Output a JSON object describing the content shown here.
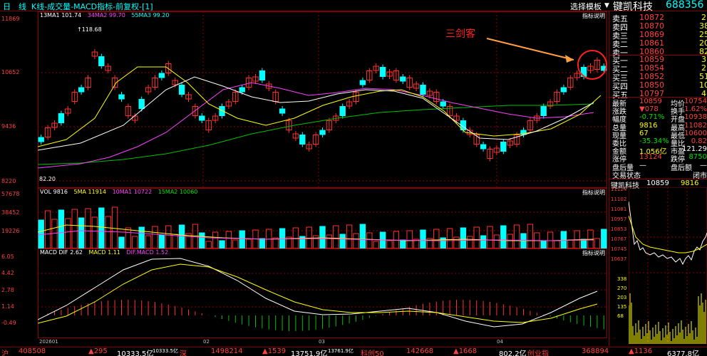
{
  "header": {
    "period_a": "日",
    "period_b": "线",
    "chart_title": "K线-成交量-MACD指标-前复权-[1]",
    "template_btn": "选择模板",
    "stock_name": "键凯科技",
    "stock_code": "688356"
  },
  "main_chart": {
    "legend": {
      "ma1": "13MA1 101.74",
      "ma2": "34MA2 99.70",
      "ma3": "55MA3 99.20"
    },
    "explain": "指标说明",
    "high_label": "118.68",
    "low_label": "82.20",
    "y_ticks": [
      "11869",
      "10652",
      "9436",
      "8220"
    ],
    "annotation": "三剑客"
  },
  "volume_chart": {
    "legend": {
      "vol": "VOL 9816",
      "ma5": "5MA 11914",
      "ma10": "10MA1 10722",
      "ma15": "15MA2 10060"
    },
    "explain": "指标说明",
    "y_ticks": [
      "57678",
      "38452",
      "19226"
    ]
  },
  "macd_chart": {
    "legend": {
      "dif": "MACD DIF 2.62",
      "macd": "MACD 1.11",
      "difmacd": "DIF.MACD 1.52"
    },
    "explain": "指标说明",
    "y_ticks": [
      "6.05",
      "4.42",
      "2.78",
      "1.14",
      "-0.49"
    ]
  },
  "x_axis": [
    "202601",
    "02",
    "03",
    "04"
  ],
  "order_book": {
    "sells": [
      {
        "label": "卖五",
        "price": "10872",
        "vol": "2"
      },
      {
        "label": "卖四",
        "price": "10870",
        "vol": "38"
      },
      {
        "label": "卖三",
        "price": "10869",
        "vol": "25"
      },
      {
        "label": "卖二",
        "price": "10861",
        "vol": "20"
      },
      {
        "label": "卖一",
        "price": "10860",
        "vol": "82"
      }
    ],
    "buys": [
      {
        "label": "买一",
        "price": "10859",
        "vol": "3"
      },
      {
        "label": "买二",
        "price": "10854",
        "vol": "2"
      },
      {
        "label": "买三",
        "price": "10852",
        "vol": "51"
      },
      {
        "label": "买四",
        "price": "10850",
        "vol": "10"
      },
      {
        "label": "买五",
        "price": "10797",
        "vol": "4"
      }
    ]
  },
  "stats": [
    {
      "l1": "最新",
      "v1": "10859",
      "l2": "均价",
      "v2": "10754"
    },
    {
      "l1": "涨跌",
      "v1": "▼078",
      "l2": "换手",
      "v2": "1.62%"
    },
    {
      "l1": "幅度",
      "v1": "-0.71%",
      "l2": "开盘",
      "v2": "10938"
    },
    {
      "l1": "总量",
      "v1": "9816",
      "l2": "最高",
      "v2": "11082"
    },
    {
      "l1": "现量",
      "v1": "67",
      "l2": "最低",
      "v2": "10600"
    },
    {
      "l1": "委比",
      "v1": "-35.34%",
      "l2": "量比",
      "v2": "0.82"
    },
    {
      "l1": "金额",
      "v1": "1.056亿",
      "l2": "市盈",
      "v2": "121.29"
    },
    {
      "l1": "涨停",
      "v1": "13124",
      "l2": "跌停",
      "v2": "8750"
    },
    {
      "l1": "盘后量",
      "v1": "—",
      "l2": "盘后额",
      "v2": "—"
    },
    {
      "l1": "交易状态",
      "v1": "",
      "l2": "",
      "v2": "闭市"
    }
  ],
  "intraday": {
    "name": "键凯科技",
    "price": "10859",
    "vol": "9816",
    "y_ticks": [
      "11124",
      "11102",
      "11081",
      "10957",
      "10853",
      "10767",
      "10745",
      "10637"
    ],
    "vol_ticks": [
      "338",
      "270",
      "203",
      "135",
      "68"
    ]
  },
  "status_bar": {
    "sh_label": "沪",
    "sh_val": "408508",
    "sh_chg": "▲295",
    "sh_idx": "10333.5亿",
    "sh_idx2": "10333.5亿",
    "sz_label": "深",
    "sz_val": "1498214",
    "sz_chg": "▲1539",
    "sz_idx": "13751.9亿",
    "sz_idx2": "13761.9亿",
    "kc_label": "科创50",
    "kc_val": "142668",
    "kc_chg": "▲1668",
    "kc_amt": "802.2亿",
    "cy_label": "创业指",
    "cy_val": "368894",
    "cy_chg": "▲1136",
    "cy_amt": "6377.8亿"
  }
}
